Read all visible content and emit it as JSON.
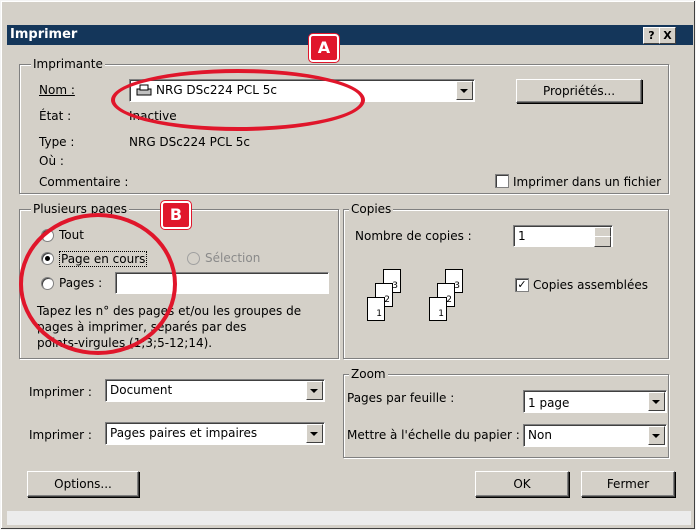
{
  "window": {
    "title": "Imprimer",
    "help_btn": "?",
    "close_btn": "X"
  },
  "printer": {
    "group_label": "Imprimante",
    "name_label": "Nom :",
    "name_value": "NRG DSc224 PCL 5c",
    "state_label": "État :",
    "state_value": "Inactive",
    "type_label": "Type :",
    "type_value": "NRG DSc224 PCL 5c",
    "where_label": "Où :",
    "comment_label": "Commentaire :",
    "properties_btn": "Propriétés...",
    "print_to_file_label": "Imprimer dans un fichier",
    "print_to_file_checked": false
  },
  "pages": {
    "group_label": "Plusieurs pages",
    "all_label": "Tout",
    "current_label": "Page en cours",
    "selection_label": "Sélection",
    "pages_label": "Pages :",
    "pages_value": "",
    "selected": "current",
    "hint": [
      "Tapez les n° des pages et/ou les groupes de",
      "pages à imprimer, séparés par des",
      "points-virgules (1;3;5-12;14)."
    ]
  },
  "copies": {
    "group_label": "Copies",
    "count_label": "Nombre de copies :",
    "count_value": "1",
    "collate_label": "Copies assemblées",
    "collate_checked": true,
    "page_numbers": [
      "3",
      "2",
      "1"
    ]
  },
  "print_what": {
    "label": "Imprimer :",
    "value": "Document"
  },
  "print_range": {
    "label": "Imprimer :",
    "value": "Pages paires et impaires"
  },
  "zoom": {
    "group_label": "Zoom",
    "pages_per_sheet_label": "Pages par feuille :",
    "pages_per_sheet_value": "1 page",
    "scale_label": "Mettre à l'échelle du papier :",
    "scale_value": "Non"
  },
  "footer": {
    "options_btn": "Options...",
    "ok_btn": "OK",
    "close_btn": "Fermer"
  },
  "annotations": {
    "a_label": "A",
    "b_label": "B",
    "color": "#e0162b"
  }
}
